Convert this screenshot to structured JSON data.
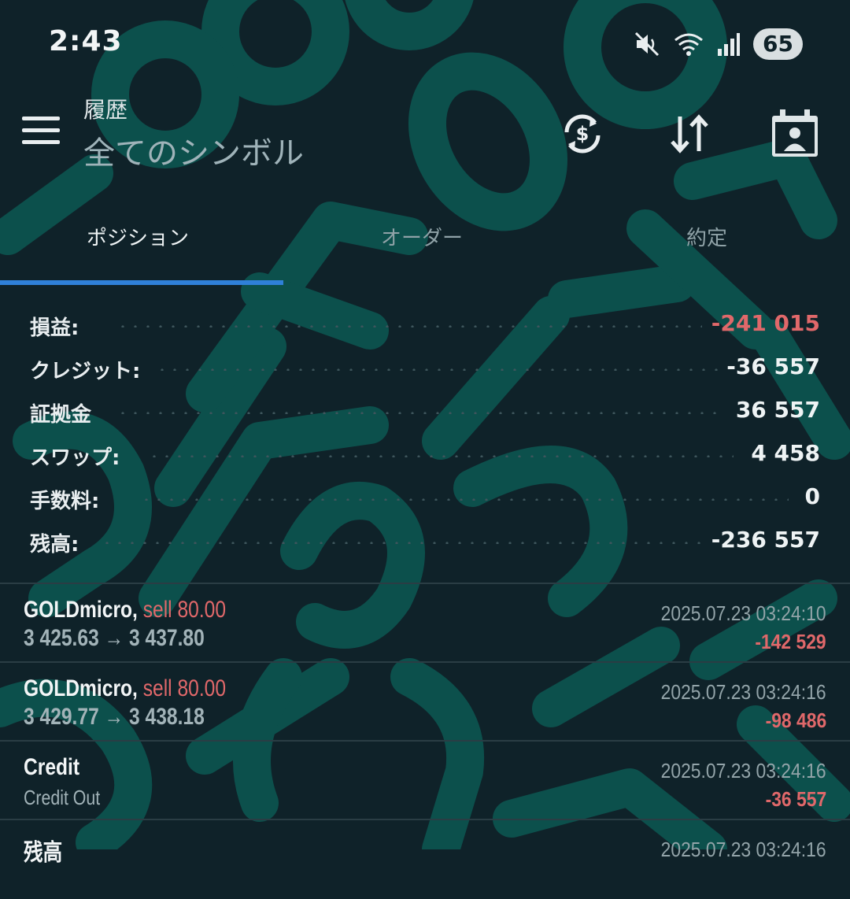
{
  "status_bar": {
    "time": "2:43",
    "battery": "65",
    "icons": [
      "mute-icon",
      "wifi-icon",
      "signal-icon"
    ]
  },
  "app_bar": {
    "title": "履歴",
    "subtitle": "全てのシンボル",
    "actions": [
      "currency-sync-icon",
      "sort-icon",
      "calendar-contact-icon"
    ]
  },
  "tabs": [
    {
      "label": "ポジション",
      "active": true
    },
    {
      "label": "オーダー",
      "active": false
    },
    {
      "label": "約定",
      "active": false
    }
  ],
  "summary": [
    {
      "label": "損益:",
      "value": "-241 015",
      "negative": true
    },
    {
      "label": "クレジット:",
      "value": "-36 557",
      "negative": false
    },
    {
      "label": "証拠金",
      "value": "36 557",
      "negative": false
    },
    {
      "label": "スワップ:",
      "value": "4 458",
      "negative": false
    },
    {
      "label": "手数料:",
      "value": "0",
      "negative": false
    },
    {
      "label": "残高:",
      "value": "-236 557",
      "negative": false
    }
  ],
  "history": [
    {
      "symbol": "GOLDmicro,",
      "side": "sell 80.00",
      "prices": "3 425.63 → 3 437.80",
      "time": "2025.07.23 03:24:10",
      "profit": "-142 529"
    },
    {
      "symbol": "GOLDmicro,",
      "side": "sell 80.00",
      "prices": "3 429.77 → 3 438.18",
      "time": "2025.07.23 03:24:16",
      "profit": "-98 486"
    },
    {
      "symbol": "Credit",
      "side": "",
      "prices": "Credit Out",
      "time": "2025.07.23 03:24:16",
      "profit": "-36 557"
    },
    {
      "symbol": "残高",
      "side": "",
      "prices": "",
      "time": "2025.07.23 03:24:16",
      "profit": ""
    }
  ],
  "watermark": {
    "text": "EmuLog@ガジェット&ワーク",
    "color": "#0c5550"
  },
  "colors": {
    "background": "#0f2229",
    "negative": "#e0686a",
    "tab_indicator": "#2f80d8"
  }
}
